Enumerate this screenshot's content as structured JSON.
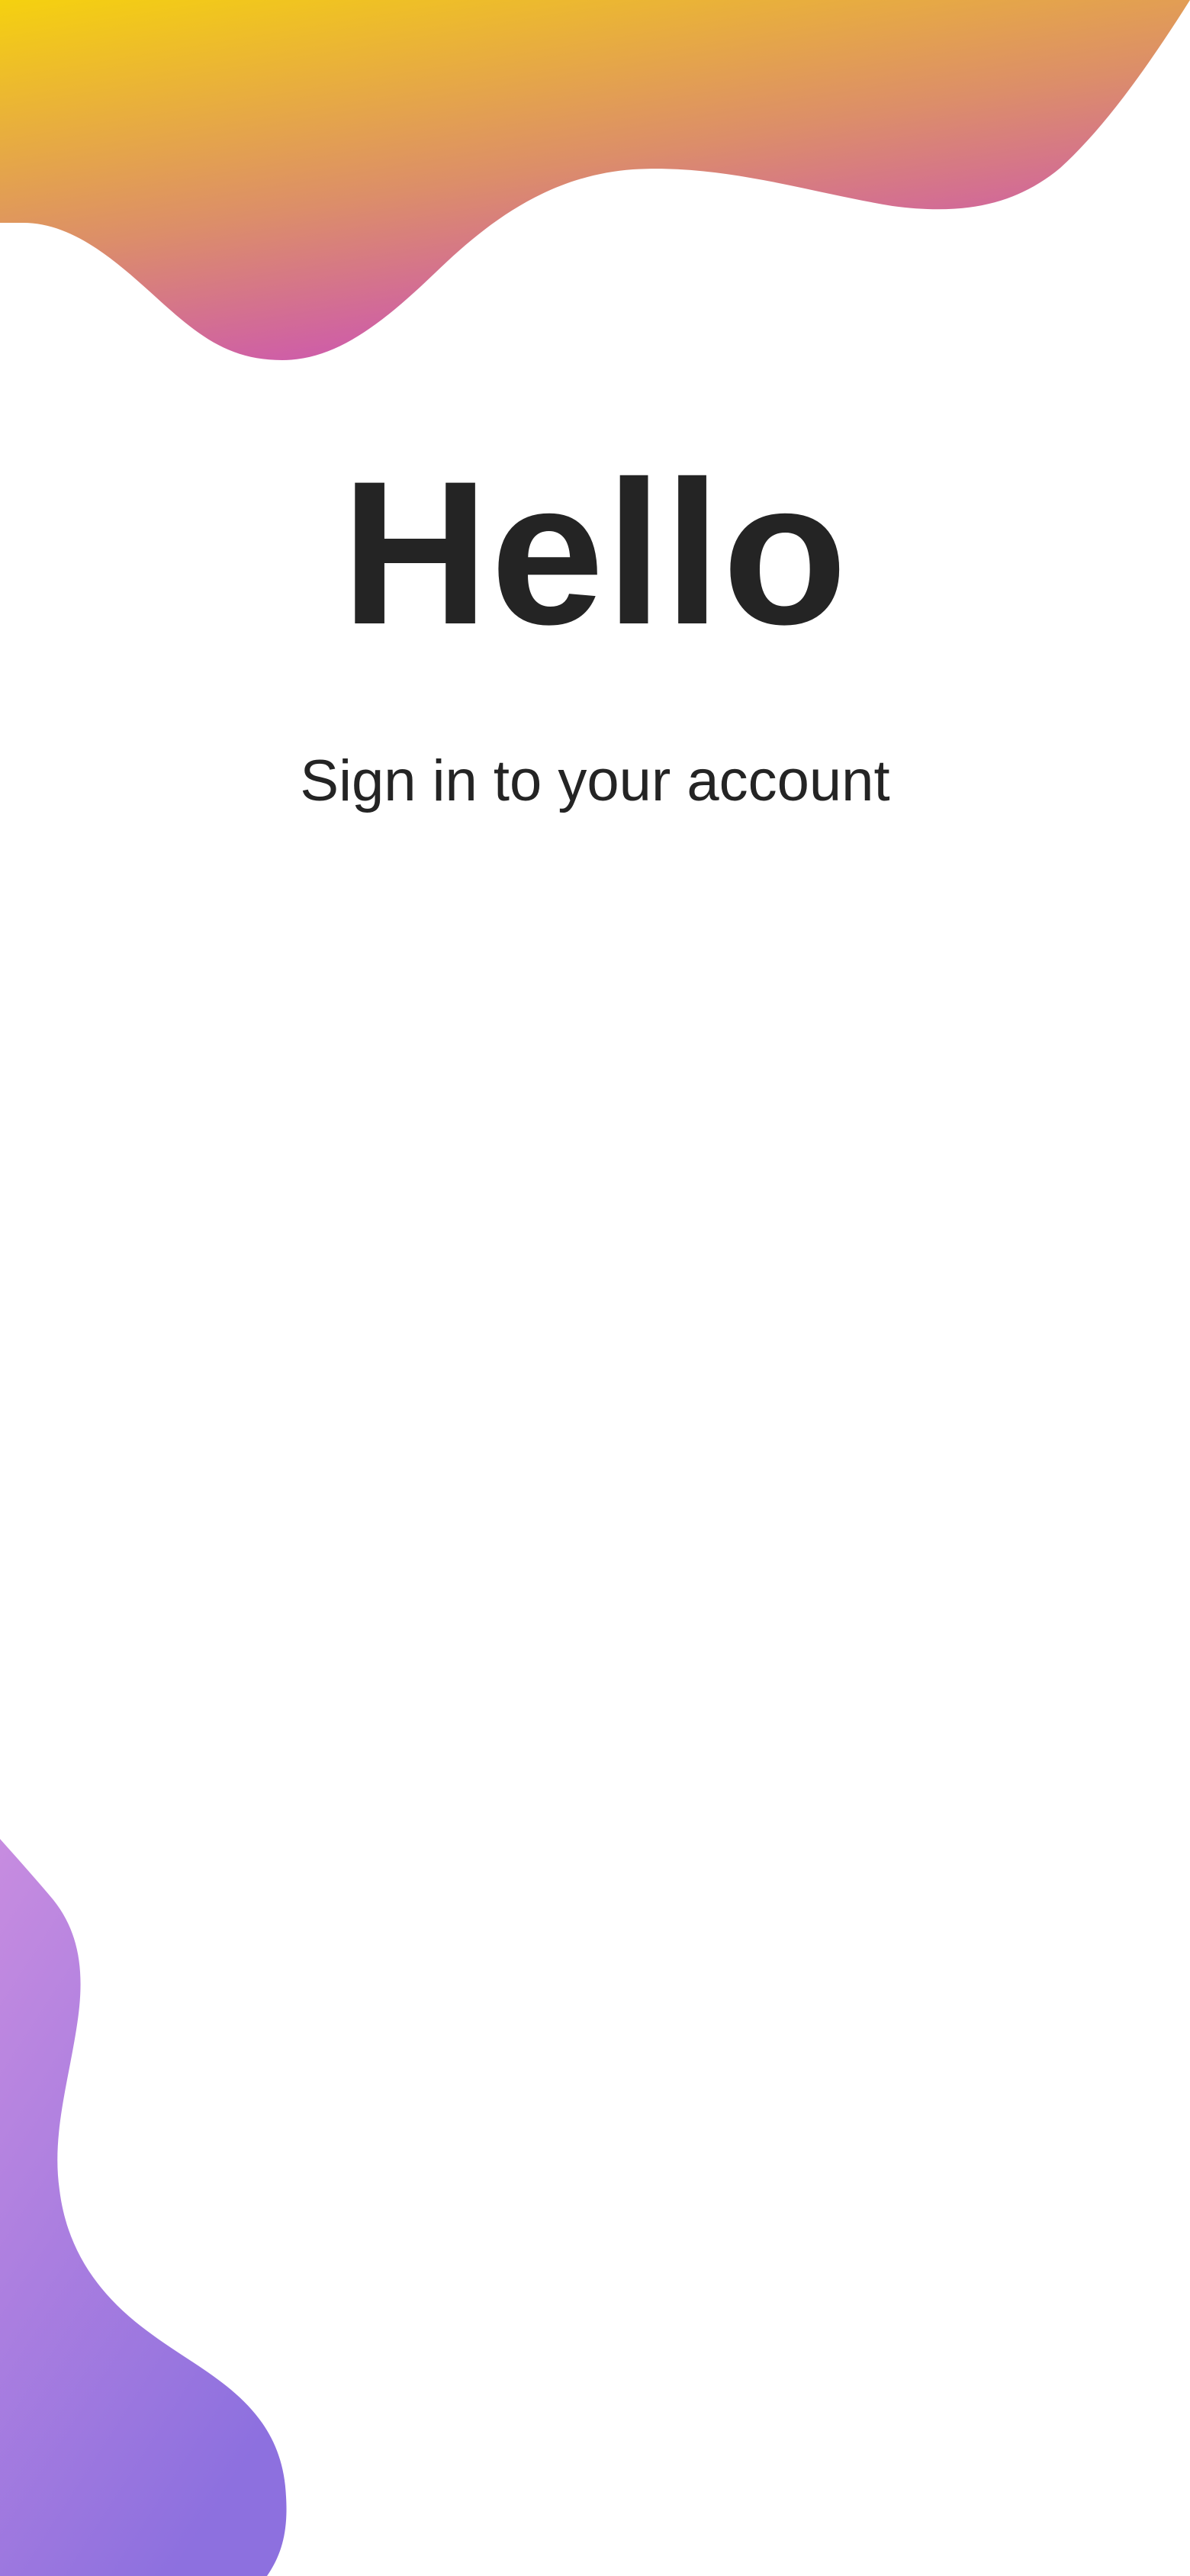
{
  "screen": {
    "title": "Hello",
    "subtitle": "Sign in to your account"
  },
  "decorations": {
    "top_wave_colors": [
      "#f5d10f",
      "#dc8e69",
      "#c94bc0"
    ],
    "bottom_wave_colors": [
      "#c78ce0",
      "#8d70df"
    ]
  }
}
